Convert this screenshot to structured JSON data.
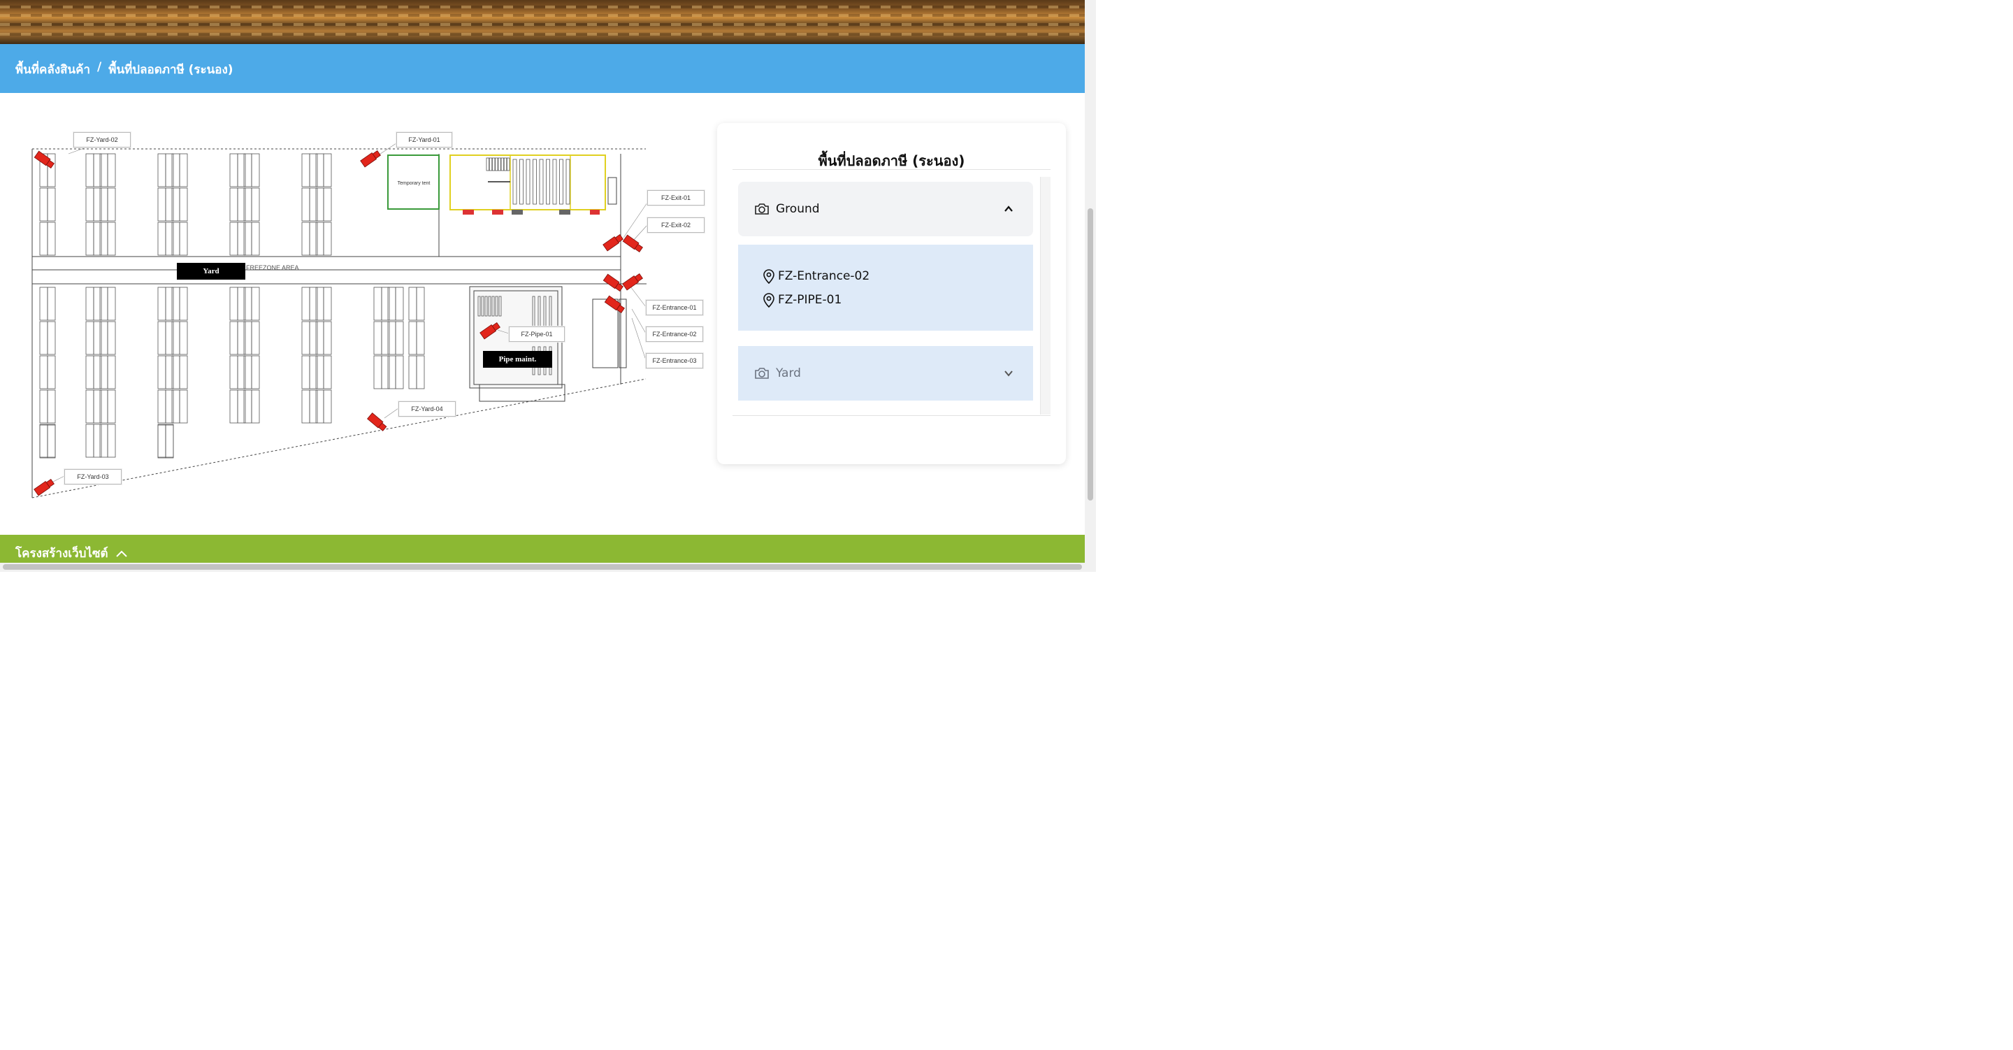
{
  "breadcrumb": {
    "items": [
      "พื้นที่คลังสินค้า",
      "พื้นที่ปลอดภาษี (ระนอง)"
    ],
    "separator": "/"
  },
  "map": {
    "camera_labels": {
      "yard_02": "FZ-Yard-02",
      "yard_01": "FZ-Yard-01",
      "exit_01": "FZ-Exit-01",
      "exit_02": "FZ-Exit-02",
      "entrance_01": "FZ-Entrance-01",
      "entrance_02": "FZ-Entrance-02",
      "entrance_03": "FZ-Entrance-03",
      "pipe_01": "FZ-Pipe-01",
      "yard_04": "FZ-Yard-04",
      "yard_03": "FZ-Yard-03"
    },
    "zone_labels": {
      "yard": "Yard",
      "pipe": "Pipe maint."
    },
    "temporary_tent": "Temporary tent",
    "freezone_text": "FREEZONE  AREA",
    "colors": {
      "camera": "#e2261c",
      "tent_border": "#3a9a3a",
      "building_border": "#e0d020"
    }
  },
  "panel": {
    "title": "พื้นที่ปลอดภาษี (ระนอง)",
    "groups": [
      {
        "name": "Ground",
        "expanded": true,
        "icon": "camera-icon",
        "chevron": "chevron-up-icon",
        "locations": [
          "FZ-Entrance-02",
          "FZ-PIPE-01"
        ]
      },
      {
        "name": "Yard",
        "expanded": false,
        "icon": "camera-icon",
        "chevron": "chevron-down-icon"
      }
    ]
  },
  "footer": {
    "label": "โครงสร้างเว็บไซต์",
    "icon": "chevron-up-icon",
    "color": "#8cb833"
  },
  "theme": {
    "header_bar": "#4daae8",
    "accordion_head": "#f2f3f5",
    "accordion_body": "#deeaf8"
  }
}
